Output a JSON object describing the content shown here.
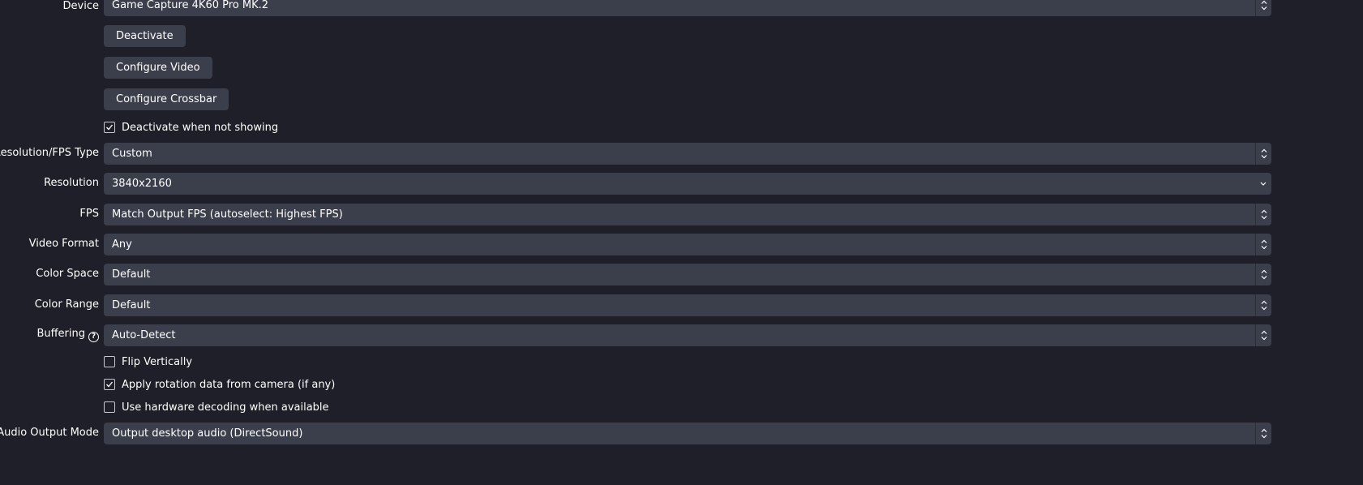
{
  "device": {
    "label": "Device",
    "value": "Game Capture 4K60 Pro MK.2"
  },
  "buttons": {
    "deactivate": "Deactivate",
    "configure_video": "Configure Video",
    "configure_crossbar": "Configure Crossbar"
  },
  "deactivate_when_not_showing": {
    "label": "Deactivate when not showing",
    "checked": true
  },
  "resolution_fps_type": {
    "label": "Resolution/FPS Type",
    "value": "Custom"
  },
  "resolution": {
    "label": "Resolution",
    "value": "3840x2160"
  },
  "fps": {
    "label": "FPS",
    "value": "Match Output FPS (autoselect: Highest FPS)"
  },
  "video_format": {
    "label": "Video Format",
    "value": "Any"
  },
  "color_space": {
    "label": "Color Space",
    "value": "Default"
  },
  "color_range": {
    "label": "Color Range",
    "value": "Default"
  },
  "buffering": {
    "label": "Buffering",
    "help_glyph": "?",
    "value": "Auto-Detect"
  },
  "flip_vertically": {
    "label": "Flip Vertically",
    "checked": false
  },
  "apply_rotation": {
    "label": "Apply rotation data from camera (if any)",
    "checked": true
  },
  "hardware_decoding": {
    "label": "Use hardware decoding when available",
    "checked": false
  },
  "audio_output_mode": {
    "label": "Audio Output Mode",
    "value": "Output desktop audio (DirectSound)"
  },
  "icons": {
    "updown": "chevron-up-down-icon",
    "down": "chevron-down-icon",
    "check": "checkmark-icon",
    "help": "help-icon"
  },
  "colors": {
    "background": "#1e1f28",
    "control": "#3b3e4b",
    "text": "#ffffff"
  }
}
